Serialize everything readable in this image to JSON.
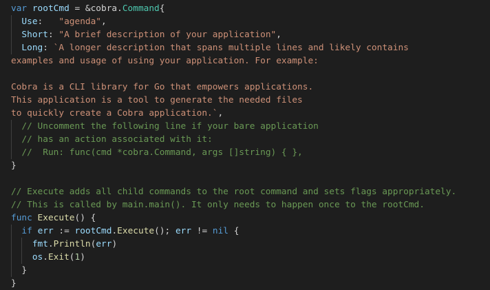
{
  "colors": {
    "background": "#1e1e1e",
    "plain": "#d4d4d4",
    "keyword": "#569cd6",
    "variable": "#9cdcfe",
    "function": "#dcdcaa",
    "type": "#4ec9b0",
    "string": "#ce9178",
    "comment": "#6a9955",
    "number": "#b5cea8"
  },
  "code": {
    "lines": [
      [
        [
          "kw",
          "var"
        ],
        [
          "pl",
          " "
        ],
        [
          "var",
          "rootCmd"
        ],
        [
          "pl",
          " = &cobra."
        ],
        [
          "type",
          "Command"
        ],
        [
          "pl",
          "{"
        ]
      ],
      [
        [
          "pl",
          "  "
        ],
        [
          "var",
          "Use"
        ],
        [
          "pl",
          ":   "
        ],
        [
          "str",
          "\"agenda\""
        ],
        [
          "pl",
          ","
        ]
      ],
      [
        [
          "pl",
          "  "
        ],
        [
          "var",
          "Short"
        ],
        [
          "pl",
          ": "
        ],
        [
          "str",
          "\"A brief description of your application\""
        ],
        [
          "pl",
          ","
        ]
      ],
      [
        [
          "pl",
          "  "
        ],
        [
          "var",
          "Long"
        ],
        [
          "pl",
          ": "
        ],
        [
          "str",
          "`A longer description that spans multiple lines and likely contains"
        ]
      ],
      [
        [
          "str",
          "examples and usage of using your application. For example:"
        ]
      ],
      [
        [
          "str",
          ""
        ]
      ],
      [
        [
          "str",
          "Cobra is a CLI library for Go that empowers applications."
        ]
      ],
      [
        [
          "str",
          "This application is a tool to generate the needed files"
        ]
      ],
      [
        [
          "str",
          "to quickly create a Cobra application.`"
        ],
        [
          "pl",
          ","
        ]
      ],
      [
        [
          "pl",
          "  "
        ],
        [
          "cm",
          "// Uncomment the following line if your bare application"
        ]
      ],
      [
        [
          "pl",
          "  "
        ],
        [
          "cm",
          "// has an action associated with it:"
        ]
      ],
      [
        [
          "pl",
          "  "
        ],
        [
          "cm",
          "//  Run: func(cmd *cobra.Command, args []string) { },"
        ]
      ],
      [
        [
          "pl",
          "}"
        ]
      ],
      [
        [
          "pl",
          ""
        ]
      ],
      [
        [
          "cm",
          "// Execute adds all child commands to the root command and sets flags appropriately."
        ]
      ],
      [
        [
          "cm",
          "// This is called by main.main(). It only needs to happen once to the rootCmd."
        ]
      ],
      [
        [
          "kw",
          "func"
        ],
        [
          "pl",
          " "
        ],
        [
          "fn",
          "Execute"
        ],
        [
          "pl",
          "() {"
        ]
      ],
      [
        [
          "pl",
          "  "
        ],
        [
          "kw",
          "if"
        ],
        [
          "pl",
          " "
        ],
        [
          "var",
          "err"
        ],
        [
          "pl",
          " := "
        ],
        [
          "var",
          "rootCmd"
        ],
        [
          "pl",
          "."
        ],
        [
          "fn",
          "Execute"
        ],
        [
          "pl",
          "(); "
        ],
        [
          "var",
          "err"
        ],
        [
          "pl",
          " != "
        ],
        [
          "kw",
          "nil"
        ],
        [
          "pl",
          " {"
        ]
      ],
      [
        [
          "pl",
          "    "
        ],
        [
          "var",
          "fmt"
        ],
        [
          "pl",
          "."
        ],
        [
          "fn",
          "Println"
        ],
        [
          "pl",
          "("
        ],
        [
          "var",
          "err"
        ],
        [
          "pl",
          ")"
        ]
      ],
      [
        [
          "pl",
          "    "
        ],
        [
          "var",
          "os"
        ],
        [
          "pl",
          "."
        ],
        [
          "fn",
          "Exit"
        ],
        [
          "pl",
          "("
        ],
        [
          "num",
          "1"
        ],
        [
          "pl",
          ")"
        ]
      ],
      [
        [
          "pl",
          "  }"
        ]
      ],
      [
        [
          "pl",
          "}"
        ]
      ]
    ]
  }
}
